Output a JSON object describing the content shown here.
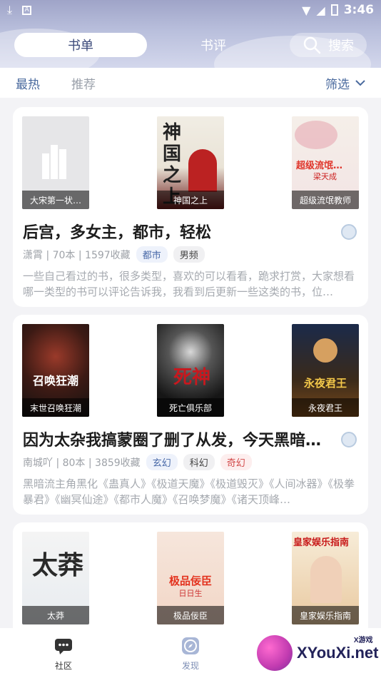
{
  "status_bar": {
    "time": "3:46"
  },
  "tabs": {
    "booklist": "书单",
    "review": "书评",
    "search": "搜索"
  },
  "filter": {
    "hot": "最热",
    "recommend": "推荐",
    "filter": "筛选"
  },
  "cards": [
    {
      "covers": [
        {
          "title": "大宋第一状…"
        },
        {
          "title": "神国之上"
        },
        {
          "title": "超级流氓教师"
        }
      ],
      "title": "后宫，多女主，都市，轻松",
      "meta": "潇霄 | 70本 | 1597收藏",
      "tags": [
        "都市",
        "男频"
      ],
      "description": "一些自己看过的书，很多类型，喜欢的可以看看，跪求打赏，大家想看哪一类型的书可以评论告诉我，我看到后更新一些这类的书，位…"
    },
    {
      "covers": [
        {
          "title": "末世召唤狂潮"
        },
        {
          "title": "死亡俱乐部"
        },
        {
          "title": "永夜君王"
        }
      ],
      "title": "因为太杂我搞蒙圈了删了从发，今天黑暗…",
      "meta": "南城吖 | 80本 | 3859收藏",
      "tags": [
        "玄幻",
        "科幻",
        "奇幻"
      ],
      "description": "黑暗流主角黑化《蛊真人》《极道天魔》《极道毁灭》《人间冰器》《极拳暴君》《幽冥仙途》《都市人魔》《召唤梦魔》《诸天顶峰…"
    },
    {
      "covers": [
        {
          "title": "太莽"
        },
        {
          "title": "极品佞臣"
        },
        {
          "title": "皇家娱乐指南"
        }
      ]
    }
  ],
  "cover_art_text": {
    "shenguo": "神国之上",
    "chaoji": "超级流氓…",
    "chaoji_author": "梁天成",
    "moshi": "召唤狂潮",
    "siwang": "死神",
    "yongye": "永夜君王",
    "taimang": "太莽",
    "jipin": "极品佞臣",
    "jipin_sub": "日日生",
    "huangjia": "皇家娱乐指南"
  },
  "bottom_nav": {
    "community": "社区",
    "discover": "发现"
  },
  "watermark": {
    "site": "XYouXi.net",
    "small": "X游戏"
  },
  "colors": {
    "accent": "#4a6a9e",
    "tag_red": "#d24a4a"
  }
}
